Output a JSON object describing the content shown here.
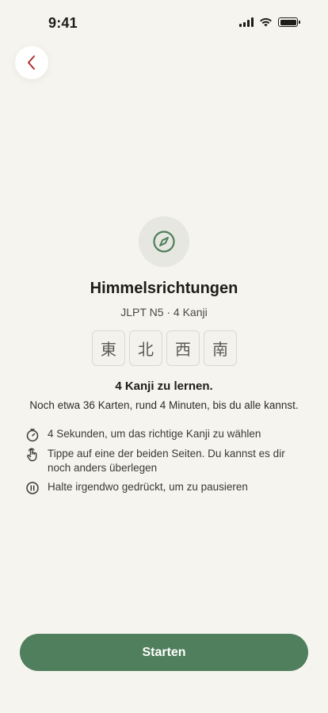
{
  "status_bar": {
    "time": "9:41",
    "icons": [
      "signal-icon",
      "wifi-icon",
      "battery-icon"
    ]
  },
  "nav": {
    "back_icon": "chevron-left-icon"
  },
  "hero": {
    "icon": "compass-icon",
    "title": "Himmelsrichtungen",
    "subtitle": "JLPT N5 · 4 Kanji"
  },
  "kanji": [
    "東",
    "北",
    "西",
    "南"
  ],
  "summary": {
    "title": "4 Kanji zu lernen.",
    "description": "Noch etwa 36 Karten, rund 4 Minuten, bis du alle kannst."
  },
  "tips": [
    {
      "icon": "timer-icon",
      "text": "4 Sekunden, um das richtige Kanji zu wählen"
    },
    {
      "icon": "tap-hand-icon",
      "text": "Tippe auf eine der beiden Seiten. Du kannst es dir noch anders überlegen"
    },
    {
      "icon": "pause-icon",
      "text": "Halte irgendwo gedrückt, um zu pausieren"
    }
  ],
  "start_button": {
    "label": "Starten"
  },
  "colors": {
    "background": "#f6f4ee",
    "accent": "#4f7f5c",
    "back_chevron": "#b2312b",
    "compass_circle": "#e6e7e0"
  }
}
